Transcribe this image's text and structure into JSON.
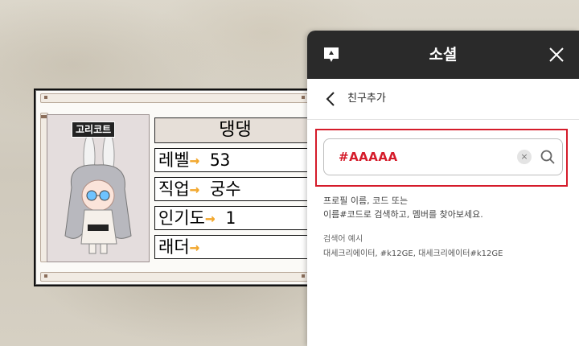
{
  "character_card": {
    "name_tag": "고리코트",
    "name": "댕댕",
    "rows": [
      {
        "label": "레벨",
        "value": "53"
      },
      {
        "label": "직업",
        "value": "궁수"
      },
      {
        "label": "인기도",
        "value": "1"
      },
      {
        "label": "래더",
        "value": ""
      }
    ],
    "arrow": "→"
  },
  "social_panel": {
    "title": "소셜",
    "close_icon": "close-icon",
    "app_icon": "chat-bubble-icon",
    "subheader": {
      "back_icon": "chevron-left-icon",
      "title": "친구추가"
    },
    "search": {
      "value": "#AAAAA",
      "clear_label": "×",
      "search_icon": "magnifier-icon"
    },
    "help_line1": "프로필 이름, 코드 또는",
    "help_line2": "이름#코드로 검색하고, 멤버를 찾아보세요.",
    "example_label": "검색어 예시",
    "example_value": "대세크리에이터, #k12GE, 대세크리에이터#k12GE"
  },
  "colors": {
    "highlight": "#d51b2a",
    "titlebar": "#2a2a2a",
    "arrow": "#f2a72c"
  }
}
